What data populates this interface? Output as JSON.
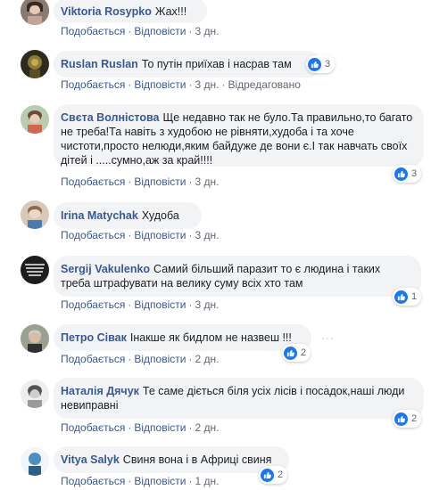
{
  "comments": [
    {
      "author": "Viktoria Rosypko",
      "text": "Жах!!!",
      "like": "Подобається",
      "reply": "Відповісти",
      "time": "3 дн.",
      "edited": "",
      "reactions": "",
      "avatar_color": "#7a6a63"
    },
    {
      "author": "Ruslan Ruslan",
      "text": "То путін приїхав і насрав там",
      "like": "Подобається",
      "reply": "Відповісти",
      "time": "3 дн.",
      "edited": "Відредаговано",
      "reactions": "3",
      "avatar_color": "#3d3a27"
    },
    {
      "author": "Свєта Волністова",
      "text": "Ще недавно так не було.Та правильно,то багато не треба!Та навіть з худобою не рівняти,худоба і та хоче чистоти,просто нелюди,яким байдуже де вони є.І так навчать своїх дітей і .....сумно,аж за край!!!!",
      "like": "Подобається",
      "reply": "Відповісти",
      "time": "3 дн.",
      "edited": "",
      "reactions": "3",
      "avatar_color": "#a9c0a2"
    },
    {
      "author": "Irina Matychak",
      "text": "Худоба",
      "like": "Подобається",
      "reply": "Відповісти",
      "time": "3 дн.",
      "edited": "",
      "reactions": "",
      "avatar_color": "#c9b8a6"
    },
    {
      "author": "Sergij Vakulenko",
      "text": "Самий більший паразит то є людина і таких треба штрафувати на велику суму всіх хто там",
      "like": "Подобається",
      "reply": "Відповісти",
      "time": "3 дн.",
      "edited": "",
      "reactions": "1",
      "avatar_color": "#2a2a2a"
    },
    {
      "author": "Петро Сівак",
      "text": "Інакше як бидлом не назвеш !!!",
      "like": "Подобається",
      "reply": "Відповісти",
      "time": "2 дн.",
      "edited": "",
      "reactions": "2",
      "avatar_color": "#8b8f86"
    },
    {
      "author": "Наталія Дячук",
      "text": "Те саме діється біля усіх лісів і посадок,наші люди невиправні",
      "like": "Подобається",
      "reply": "Відповісти",
      "time": "2 дн.",
      "edited": "",
      "reactions": "2",
      "avatar_color": "#d9d9d9"
    },
    {
      "author": "Vitya Salyk",
      "text": "Свиня вона і в Африці свиня",
      "like": "Подобається",
      "reply": "Відповісти",
      "time": "1 дн.",
      "edited": "",
      "reactions": "2",
      "avatar_color": "#4a8fbf"
    }
  ],
  "more_icon_glyph": "···",
  "accent_link": "#385898",
  "like_color": "#1877f2"
}
